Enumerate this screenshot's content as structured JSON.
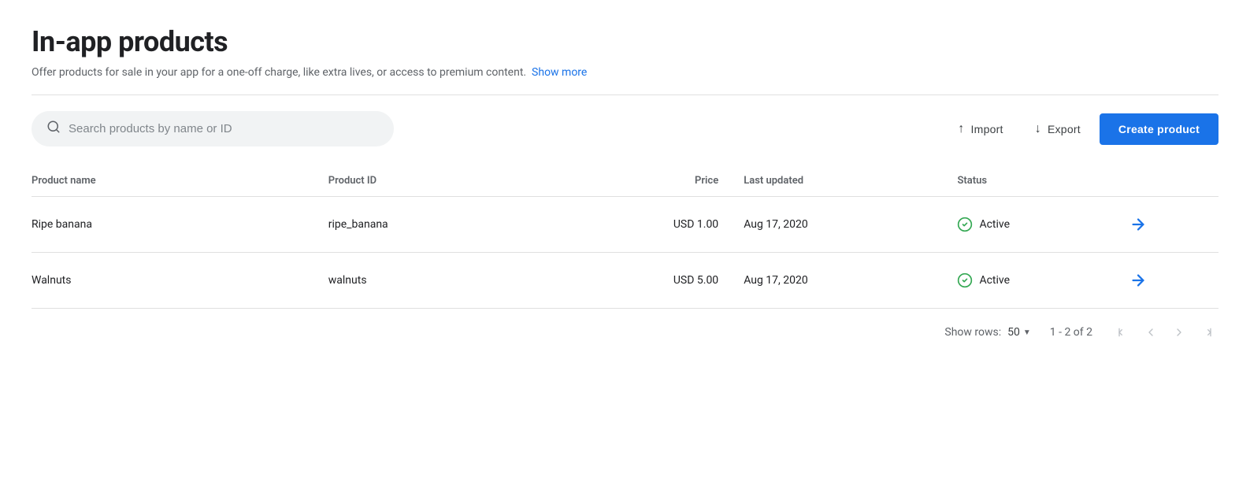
{
  "page": {
    "title": "In-app products",
    "description": "Offer products for sale in your app for a one-off charge, like extra lives, or access to premium content.",
    "show_more_label": "Show more"
  },
  "toolbar": {
    "search_placeholder": "Search products by name or ID",
    "import_label": "Import",
    "export_label": "Export",
    "create_label": "Create product"
  },
  "table": {
    "columns": [
      {
        "id": "product_name",
        "label": "Product name"
      },
      {
        "id": "product_id",
        "label": "Product ID"
      },
      {
        "id": "price",
        "label": "Price"
      },
      {
        "id": "last_updated",
        "label": "Last updated"
      },
      {
        "id": "status",
        "label": "Status"
      },
      {
        "id": "action",
        "label": ""
      }
    ],
    "rows": [
      {
        "product_name": "Ripe banana",
        "product_id": "ripe_banana",
        "price": "USD 1.00",
        "last_updated": "Aug 17, 2020",
        "status": "Active",
        "status_color": "#34a853"
      },
      {
        "product_name": "Walnuts",
        "product_id": "walnuts",
        "price": "USD 5.00",
        "last_updated": "Aug 17, 2020",
        "status": "Active",
        "status_color": "#34a853"
      }
    ]
  },
  "pagination": {
    "show_rows_label": "Show rows:",
    "rows_per_page": "50",
    "page_info": "1 - 2 of 2"
  }
}
